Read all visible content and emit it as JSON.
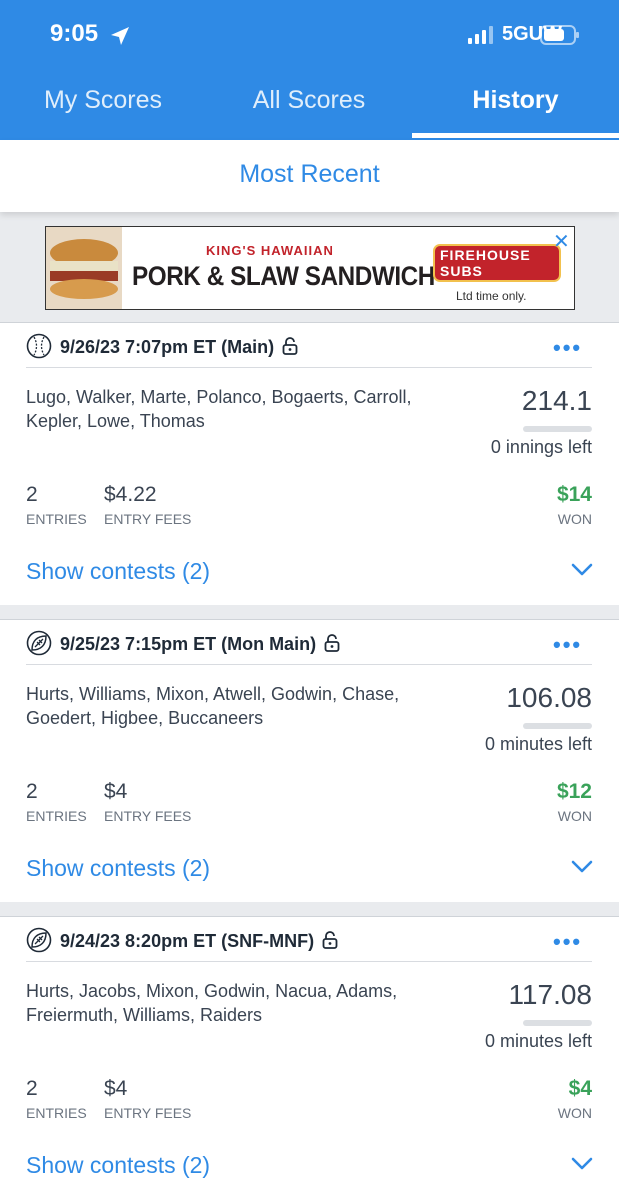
{
  "status_bar": {
    "time": "9:05",
    "network": "5GUW"
  },
  "tabs": [
    {
      "label": "My Scores"
    },
    {
      "label": "All Scores"
    },
    {
      "label": "History"
    }
  ],
  "filter": {
    "label": "Most Recent"
  },
  "ad": {
    "brand": "KING'S HAWAIIAN",
    "title": "PORK & SLAW SANDWICH",
    "partner": "FIREHOUSE SUBS",
    "subtext": "Ltd time only.",
    "close": "✕"
  },
  "colors": {
    "accent": "#2f8ae5",
    "won": "#3aa25a"
  },
  "lineups": [
    {
      "sport_icon": "baseball-icon",
      "title": "9/26/23 7:07pm ET (Main)",
      "players": "Lugo, Walker, Marte, Polanco, Bogaerts, Carroll, Kepler, Lowe, Thomas",
      "score": "214.1",
      "time_left": "0 innings left",
      "entries": "2",
      "entries_label": "ENTRIES",
      "entry_fees": "$4.22",
      "entry_fees_label": "ENTRY FEES",
      "won": "$14",
      "won_label": "WON",
      "show_contests": "Show contests (2)"
    },
    {
      "sport_icon": "football-icon",
      "title": "9/25/23 7:15pm ET (Mon Main)",
      "players": "Hurts, Williams, Mixon, Atwell, Godwin, Chase, Goedert, Higbee, Buccaneers",
      "score": "106.08",
      "time_left": "0 minutes left",
      "entries": "2",
      "entries_label": "ENTRIES",
      "entry_fees": "$4",
      "entry_fees_label": "ENTRY FEES",
      "won": "$12",
      "won_label": "WON",
      "show_contests": "Show contests (2)"
    },
    {
      "sport_icon": "football-icon",
      "title": "9/24/23 8:20pm ET (SNF-MNF)",
      "players": "Hurts, Jacobs, Mixon, Godwin, Nacua, Adams, Freiermuth, Williams, Raiders",
      "score": "117.08",
      "time_left": "0 minutes left",
      "entries": "2",
      "entries_label": "ENTRIES",
      "entry_fees": "$4",
      "entry_fees_label": "ENTRY FEES",
      "won": "$4",
      "won_label": "WON",
      "show_contests": "Show contests (2)"
    }
  ]
}
